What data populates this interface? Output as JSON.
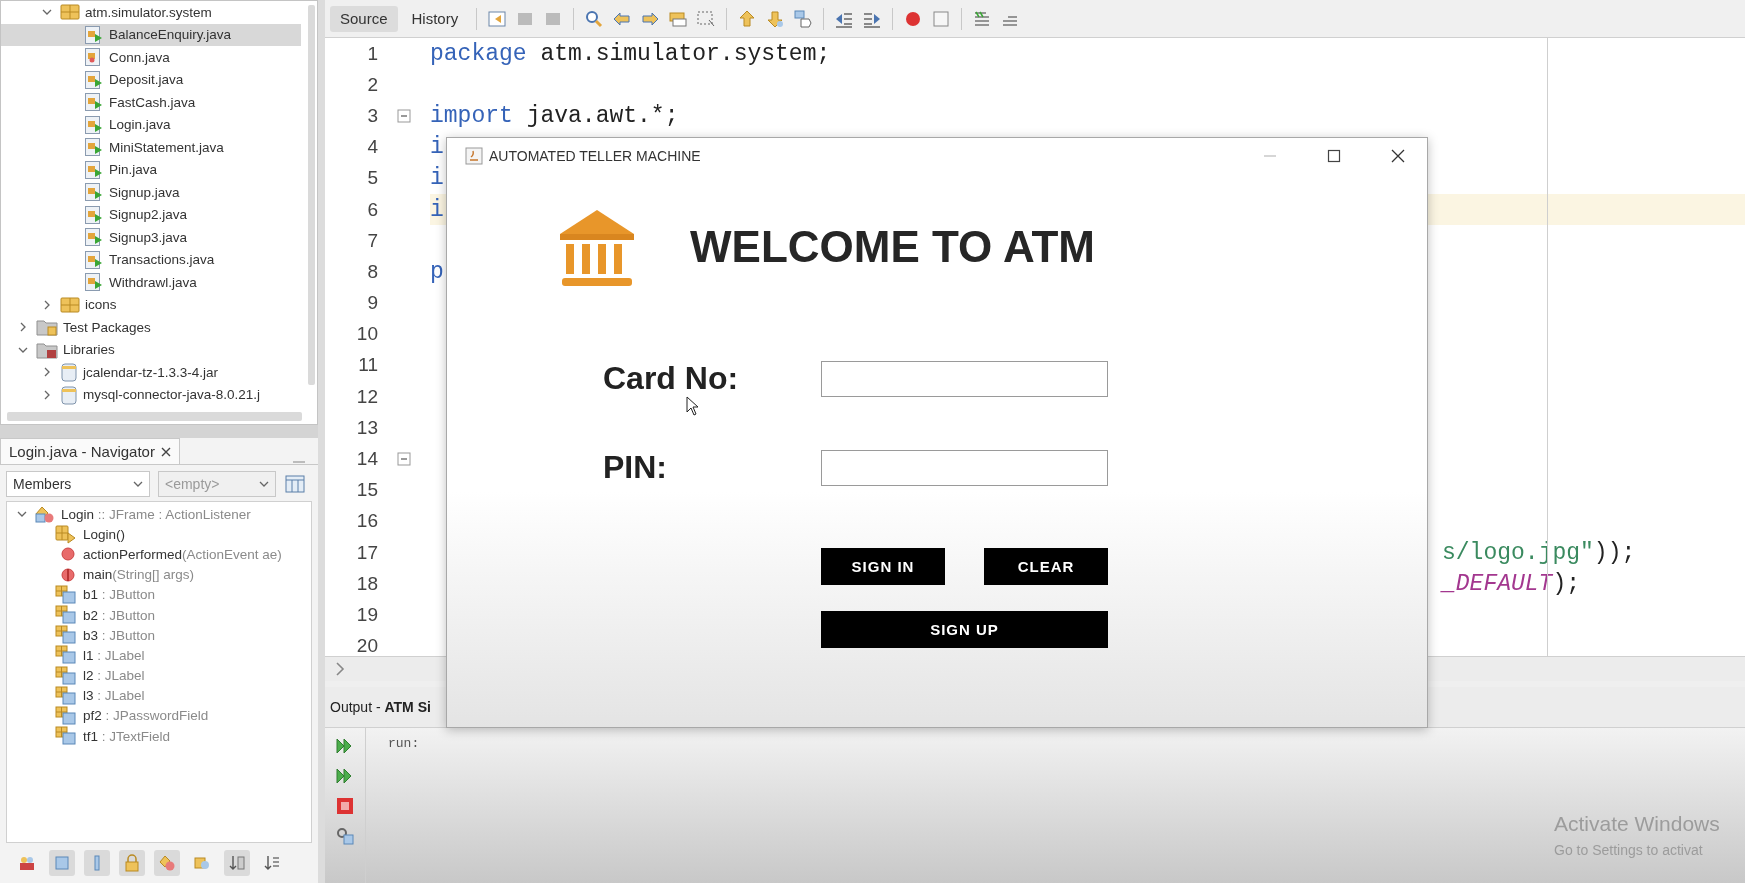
{
  "project_tree": {
    "items": [
      {
        "children": [
          {
            "label": "atm.simulator.system",
            "kind": "package",
            "expanded": true,
            "selected": false,
            "children": [
              {
                "label": "BalanceEnquiry.java",
                "kind": "runnable",
                "selected": true
              },
              {
                "label": "Conn.java",
                "kind": "class",
                "selected": false
              },
              {
                "label": "Deposit.java",
                "kind": "runnable",
                "selected": false
              },
              {
                "label": "FastCash.java",
                "kind": "runnable",
                "selected": false
              },
              {
                "label": "Login.java",
                "kind": "runnable",
                "selected": false
              },
              {
                "label": "MiniStatement.java",
                "kind": "runnable",
                "selected": false
              },
              {
                "label": "Pin.java",
                "kind": "runnable",
                "selected": false
              },
              {
                "label": "Signup.java",
                "kind": "runnable",
                "selected": false
              },
              {
                "label": "Signup2.java",
                "kind": "runnable",
                "selected": false
              },
              {
                "label": "Signup3.java",
                "kind": "runnable",
                "selected": false
              },
              {
                "label": "Transactions.java",
                "kind": "runnable",
                "selected": false
              },
              {
                "label": "Withdrawl.java",
                "kind": "runnable",
                "selected": false
              }
            ]
          },
          {
            "label": "icons",
            "kind": "package",
            "expanded": false,
            "selected": false
          }
        ]
      },
      {
        "label": "Test Packages",
        "kind": "folder",
        "expanded": false,
        "selected": false
      },
      {
        "label": "Libraries",
        "kind": "library",
        "expanded": true,
        "selected": false,
        "children": [
          {
            "label": "jcalendar-tz-1.3.3-4.jar",
            "kind": "jar",
            "expanded": false,
            "selected": false
          },
          {
            "label": "mysql-connector-java-8.0.21.j",
            "kind": "jar",
            "expanded": false,
            "selected": false
          }
        ]
      }
    ]
  },
  "navigator": {
    "tab": "Login.java - Navigator",
    "filters": [
      {
        "value": "Members",
        "disabled": false
      },
      {
        "value": "<empty>",
        "disabled": true
      }
    ],
    "members": [
      {
        "name": "Login",
        "detail": " :: JFrame : ActionListener",
        "kind": "class",
        "expanded": true,
        "children": [
          {
            "name": "Login()",
            "kind": "constructor"
          },
          {
            "name": "actionPerformed",
            "detail": "(ActionEvent ae)",
            "kind": "method"
          },
          {
            "name": "main",
            "detail": "(String[] args)",
            "kind": "static-method"
          },
          {
            "name": "b1",
            "detail": " : JButton",
            "kind": "field"
          },
          {
            "name": "b2",
            "detail": " : JButton",
            "kind": "field"
          },
          {
            "name": "b3",
            "detail": " : JButton",
            "kind": "field"
          },
          {
            "name": "l1",
            "detail": " : JLabel",
            "kind": "field"
          },
          {
            "name": "l2",
            "detail": " : JLabel",
            "kind": "field"
          },
          {
            "name": "l3",
            "detail": " : JLabel",
            "kind": "field"
          },
          {
            "name": "pf2",
            "detail": " : JPasswordField",
            "kind": "field"
          },
          {
            "name": "tf1",
            "detail": " : JTextField",
            "kind": "field"
          }
        ]
      }
    ]
  },
  "editor": {
    "tabs": [
      {
        "label": "Source",
        "selected": true
      },
      {
        "label": "History",
        "selected": false
      }
    ],
    "lines": [
      {
        "number": "1",
        "kind": "code",
        "fold": false,
        "current": false,
        "segments": [
          {
            "text": "package",
            "kind": "keyword"
          },
          {
            "text": " atm.simulator.system;",
            "kind": "plain"
          }
        ]
      },
      {
        "number": "2",
        "kind": "code",
        "fold": false,
        "current": false
      },
      {
        "number": "3",
        "kind": "code",
        "fold": true,
        "current": false,
        "segments": [
          {
            "text": "import",
            "kind": "keyword"
          },
          {
            "text": " java.awt.*;",
            "kind": "plain"
          }
        ]
      },
      {
        "number": "4",
        "kind": "code",
        "fold": false,
        "current": false,
        "segments": [
          {
            "text": "i",
            "kind": "keyword"
          }
        ]
      },
      {
        "number": "5",
        "kind": "code",
        "fold": false,
        "current": false,
        "segments": [
          {
            "text": "i",
            "kind": "keyword"
          }
        ]
      },
      {
        "number": "6",
        "kind": "code",
        "fold": false,
        "current": true,
        "segments": [
          {
            "text": "i",
            "kind": "keyword"
          }
        ]
      },
      {
        "number": "7",
        "kind": "code",
        "fold": false,
        "current": false
      },
      {
        "number": "8",
        "kind": "code",
        "fold": false,
        "current": false,
        "segments": [
          {
            "text": "p",
            "kind": "keyword"
          }
        ]
      },
      {
        "number": "9",
        "kind": "code",
        "fold": false,
        "current": false
      },
      {
        "number": "10",
        "kind": "code",
        "fold": false,
        "current": false
      },
      {
        "number": "11",
        "kind": "code",
        "fold": false,
        "current": false
      },
      {
        "number": "12",
        "kind": "code",
        "fold": false,
        "current": false
      },
      {
        "number": "13",
        "kind": "code",
        "fold": false,
        "current": false
      },
      {
        "number": "14",
        "kind": "code",
        "fold": true,
        "current": false
      },
      {
        "number": "15",
        "kind": "code",
        "fold": false,
        "current": false
      },
      {
        "number": "16",
        "kind": "code",
        "fold": false,
        "current": false
      },
      {
        "number": "17",
        "kind": "tail",
        "fold": false,
        "current": false,
        "segments": [
          {
            "text": "s/logo.jpg\"",
            "kind": "string"
          },
          {
            "text": "));",
            "kind": "plain"
          }
        ]
      },
      {
        "number": "18",
        "kind": "tail",
        "fold": false,
        "current": false,
        "segments": [
          {
            "text": "_DEFAULT",
            "kind": "constant"
          },
          {
            "text": ");",
            "kind": "plain"
          }
        ]
      },
      {
        "number": "19",
        "kind": "code",
        "fold": false,
        "current": false
      },
      {
        "number": "20",
        "kind": "code",
        "fold": false,
        "current": false
      }
    ]
  },
  "output": {
    "title": "Output - **ATM Si**",
    "text": "run:"
  },
  "dialog": {
    "title": "AUTOMATED TELLER MACHINE",
    "heading": "WELCOME TO ATM",
    "fields": [
      {
        "label": "Card No:"
      },
      {
        "label": "PIN:"
      }
    ],
    "buttons": [
      {
        "label": "SIGN IN"
      },
      {
        "label": "CLEAR"
      },
      {
        "label": "SIGN UP"
      }
    ]
  },
  "os_notice": {
    "title": "Activate Windows",
    "text": "Go to Settings to activat"
  }
}
